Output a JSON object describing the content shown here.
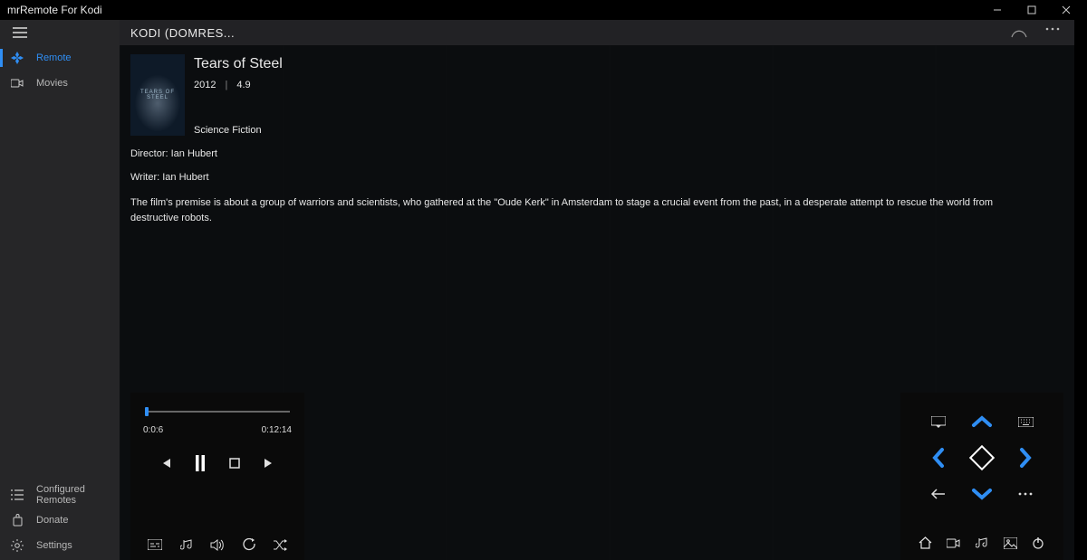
{
  "window": {
    "title": "mrRemote For Kodi"
  },
  "header": {
    "title": "KODI (DOMRES..."
  },
  "sidebar": {
    "top": [
      {
        "icon": "remote",
        "label": "Remote",
        "active": true
      },
      {
        "icon": "camera",
        "label": "Movies",
        "active": false
      }
    ],
    "bottom": [
      {
        "icon": "list",
        "label": "Configured Remotes"
      },
      {
        "icon": "donate",
        "label": "Donate"
      },
      {
        "icon": "gear",
        "label": "Settings"
      }
    ]
  },
  "movie": {
    "title": "Tears of Steel",
    "year": "2012",
    "rating": "4.9",
    "genre": "Science Fiction",
    "director_label": "Director:",
    "director": "Ian Hubert",
    "writer_label": "Writer:",
    "writer": "Ian Hubert",
    "plot": "The film's premise is about a group of warriors and scientists, who gathered at the \"Oude Kerk\" in Amsterdam to stage a crucial event from the past, in a desperate attempt to rescue the world from destructive robots.",
    "poster_text": "TEARS OF STEEL"
  },
  "playback": {
    "elapsed": "0:0:6",
    "total": "0:12:14",
    "progress_pct": 1
  },
  "colors": {
    "accent": "#2f8ef4"
  }
}
